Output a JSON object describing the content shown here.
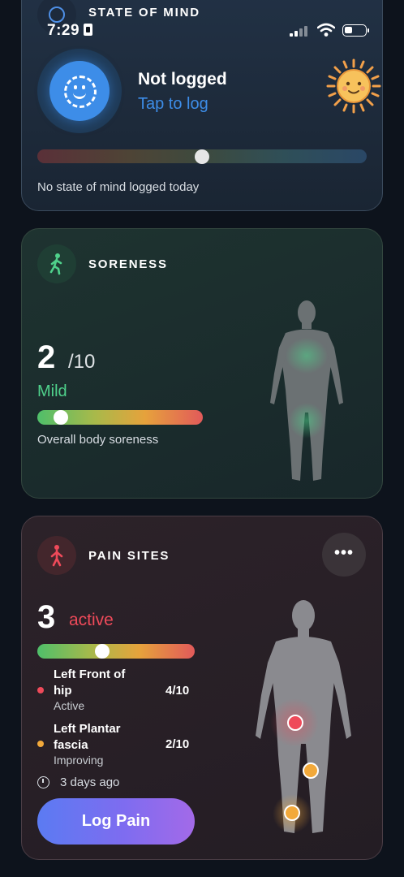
{
  "status_bar": {
    "time": "7:29"
  },
  "state_of_mind": {
    "title": "STATE OF MIND",
    "status": "Not logged",
    "action": "Tap to log",
    "note": "No state of mind logged today",
    "slider_position": 0.5
  },
  "soreness": {
    "title": "SORENESS",
    "value": "2",
    "out_of": "/10",
    "level": "Mild",
    "note": "Overall body soreness",
    "slider_position": 0.14
  },
  "pain_sites": {
    "title": "PAIN SITES",
    "count": "3",
    "count_label": "active",
    "more_label": "•••",
    "slider_position": 0.41,
    "sites": [
      {
        "name": "Left Front of hip",
        "status": "Active",
        "score": "4/10",
        "color": "#ef4a5a"
      },
      {
        "name": "Left Plantar fascia",
        "status": "Improving",
        "score": "2/10",
        "color": "#f2a93b"
      }
    ],
    "last_logged": "3 days ago",
    "button": "Log Pain"
  },
  "colors": {
    "accent_blue": "#3d8de8",
    "mild_green": "#4fd18b",
    "pain_red": "#ef4a5a",
    "improving_orange": "#f2a93b"
  }
}
